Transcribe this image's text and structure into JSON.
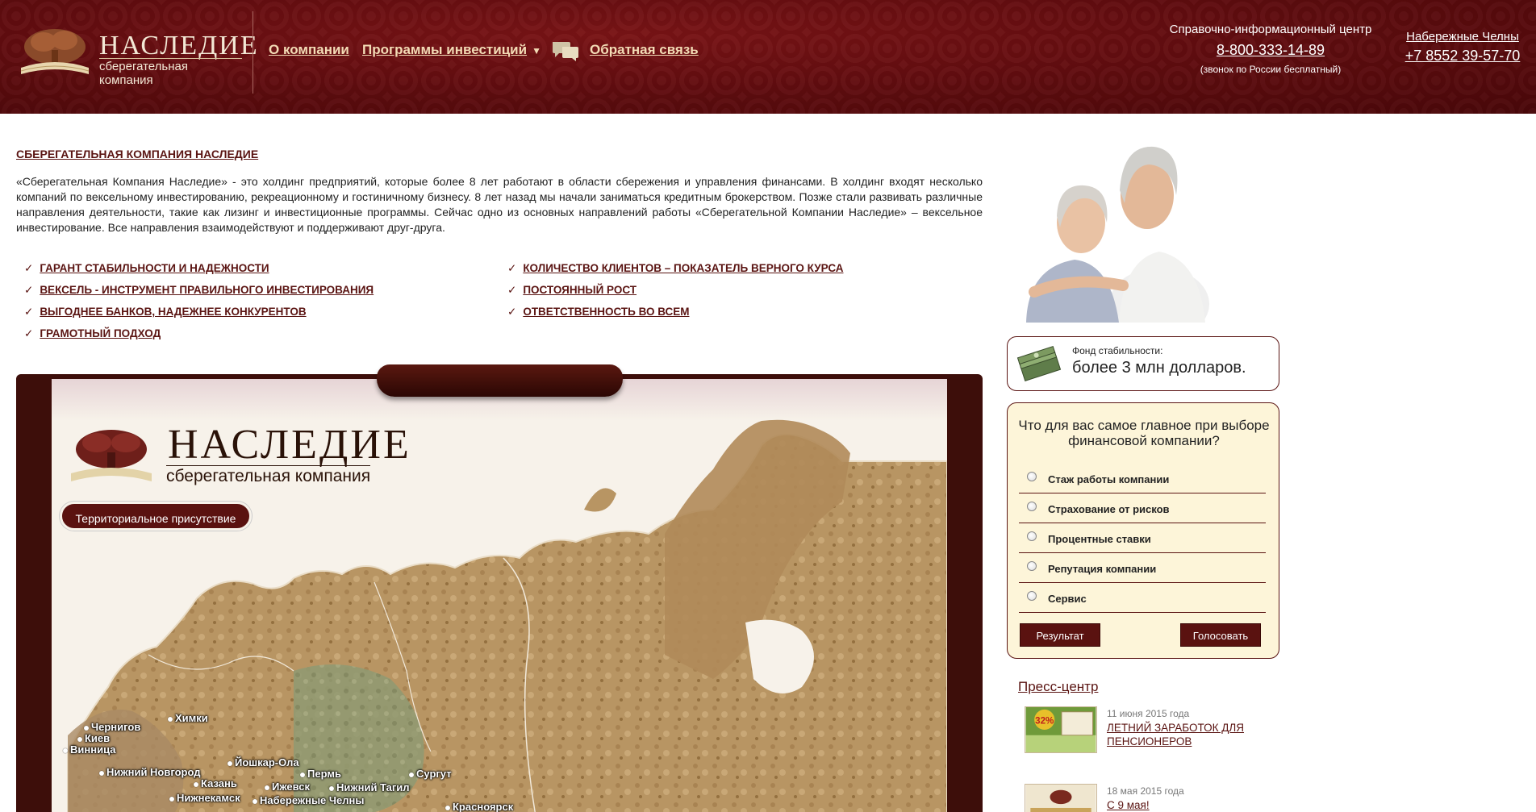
{
  "header": {
    "logo_title": "НАСЛЕДИЕ",
    "logo_subtitle": "сберегательная компания",
    "nav": {
      "about": "О компании",
      "programs": "Программы инвестиций",
      "feedback": "Обратная связь"
    },
    "info_center": {
      "title": "Справочно-информационный центр",
      "phone": "8-800-333-14-89",
      "note": "(звонок по России бесплатный)"
    },
    "city": {
      "name": "Набережные Челны",
      "phone": "+7 8552 39-57-70"
    }
  },
  "main": {
    "title": "СБЕРЕГАТЕЛЬНАЯ КОМПАНИЯ НАСЛЕДИЕ",
    "intro": "«Сберегательная Компания Наследие» - это холдинг предприятий, которые более 8 лет работают в области сбережения и управления финансами. В холдинг входят несколько компаний по вексельному инвестированию, рекреационному и гостиничному бизнесу. 8 лет назад мы начали заниматься кредитным брокерством. Позже стали развивать различные направления деятельности, такие как лизинг и инвестиционные программы. Сейчас одно из основных направлений работы «Сберегательной Компании Наследие» – вексельное инвестирование. Все направления взаимодействуют и поддерживают друг-друга.",
    "features_left": [
      "ГАРАНТ СТАБИЛЬНОСТИ И НАДЕЖНОСТИ",
      "ВЕКСЕЛЬ - ИНСТРУМЕНТ ПРАВИЛЬНОГО ИНВЕСТИРОВАНИЯ",
      "ВЫГОДНЕЕ БАНКОВ, НАДЕЖНЕЕ КОНКУРЕНТОВ",
      "ГРАМОТНЫЙ ПОДХОД"
    ],
    "features_right": [
      "КОЛИЧЕСТВО КЛИЕНТОВ – ПОКАЗАТЕЛЬ ВЕРНОГО КУРСА",
      "ПОСТОЯННЫЙ РОСТ",
      "ОТВЕТСТВЕННОСТЬ ВО ВСЕМ"
    ],
    "check_mark": "✓"
  },
  "map_board": {
    "logo_title": "НАСЛЕДИЕ",
    "logo_subtitle": "сберегательная компания",
    "territory_button": "Территориальное присутствие",
    "cities": [
      "Химки",
      "Чернигов",
      "Киев",
      "Винница",
      "Йошкар-Ола",
      "Нижний Новгород",
      "Пермь",
      "Сургут",
      "Казань",
      "Ижевск",
      "Нижний Тагил",
      "Нижнекамск",
      "Набережные Челны",
      "Красноярск"
    ]
  },
  "sidebar": {
    "fund": {
      "label": "Фонд стабильности:",
      "value": "более 3 млн долларов."
    },
    "poll": {
      "question": "Что для вас самое главное при выборе финансовой компании?",
      "options": [
        "Стаж работы компании",
        "Страхование от рисков",
        "Процентные ставки",
        "Репутация компании",
        "Сервис"
      ],
      "result_button": "Результат",
      "vote_button": "Голосовать"
    },
    "press": {
      "title": "Пресс-центр",
      "news": [
        {
          "date": "11 июня 2015 года",
          "title": "ЛЕТНИЙ ЗАРАБОТОК ДЛЯ ПЕНСИОНЕРОВ",
          "badge": "32%"
        },
        {
          "date": "18 мая 2015 года",
          "title": "С 9 мая!"
        }
      ]
    }
  }
}
